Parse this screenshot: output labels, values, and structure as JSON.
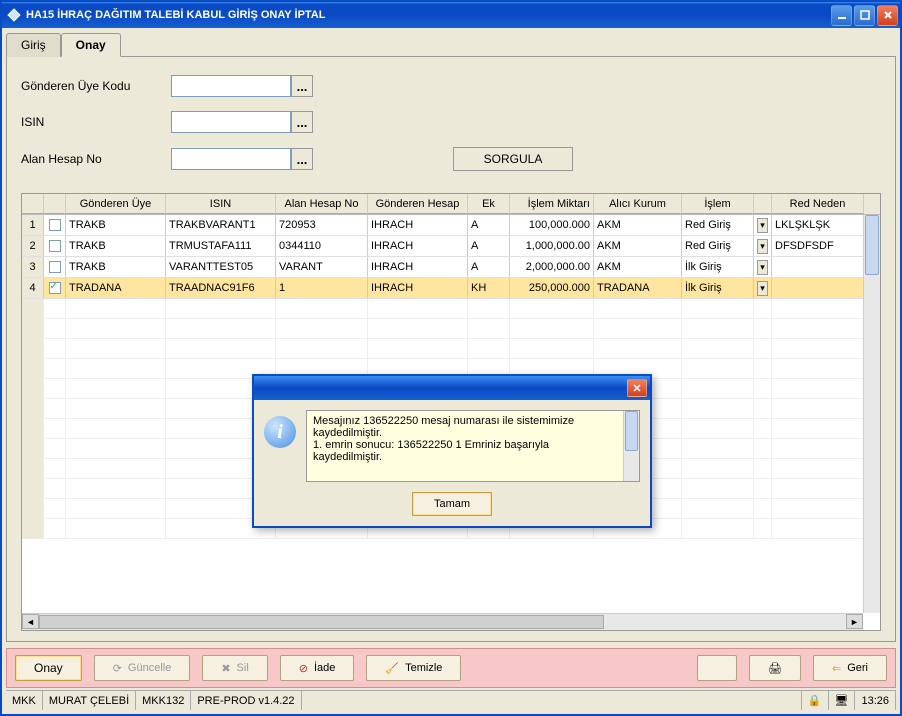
{
  "window": {
    "title": "HA15 İHRAÇ DAĞITIM TALEBİ KABUL GİRİŞ ONAY İPTAL"
  },
  "tabs": {
    "giris": "Giriş",
    "onay": "Onay"
  },
  "form": {
    "gonderen_uye_label": "Gönderen Üye Kodu",
    "isin_label": "ISIN",
    "alan_hesap_label": "Alan Hesap No",
    "gonderen_uye_value": "",
    "isin_value": "",
    "alan_hesap_value": "",
    "sorgula_label": "SORGULA"
  },
  "grid": {
    "headers": {
      "gonderen_uye": "Gönderen Üye",
      "isin": "ISIN",
      "alan_hesap": "Alan Hesap No",
      "gonderen_hesap": "Gönderen Hesap",
      "ek": "Ek",
      "islem_miktari": "İşlem Miktarı",
      "alici_kurum": "Alıcı Kurum",
      "islem": "İşlem",
      "red_neden": "Red Neden"
    },
    "rows": [
      {
        "idx": "1",
        "chk": false,
        "uye": "TRAKB",
        "isin": "TRAKBVARANT1",
        "alan": "720953",
        "gh": "IHRACH",
        "ek": "A",
        "miktar": "100,000.000",
        "kurum": "AKM",
        "islem": "Red Giriş",
        "red": "LKLŞKLŞK"
      },
      {
        "idx": "2",
        "chk": false,
        "uye": "TRAKB",
        "isin": "TRMUSTAFA111",
        "alan": "0344110",
        "gh": "IHRACH",
        "ek": "A",
        "miktar": "1,000,000.00",
        "kurum": "AKM",
        "islem": "Red Giriş",
        "red": "DFSDFSDF"
      },
      {
        "idx": "3",
        "chk": false,
        "uye": "TRAKB",
        "isin": "VARANTTEST05",
        "alan": "VARANT",
        "gh": "IHRACH",
        "ek": "A",
        "miktar": "2,000,000.00",
        "kurum": "AKM",
        "islem": "İlk Giriş",
        "red": ""
      },
      {
        "idx": "4",
        "chk": true,
        "uye": "TRADANA",
        "isin": "TRAADNAC91F6",
        "alan": "1",
        "gh": "IHRACH",
        "ek": "KH",
        "miktar": "250,000.000",
        "kurum": "TRADANA",
        "islem": "İlk Giriş",
        "red": ""
      }
    ]
  },
  "toolbar": {
    "onay": "Onay",
    "guncelle": "Güncelle",
    "sil": "Sil",
    "iade": "İade",
    "temizle": "Temizle",
    "geri": "Geri"
  },
  "statusbar": {
    "c1": "MKK",
    "c2": "MURAT ÇELEBİ",
    "c3": "MKK132",
    "c4": "PRE-PROD v1.4.22",
    "time": "13:26"
  },
  "modal": {
    "line1": "Mesajınız 136522250 mesaj numarası ile sistemimize kaydedilmiştir.",
    "line2": "1. emrin sonucu:  136522250   1   Emriniz başarıyla kaydedilmiştir.",
    "ok": "Tamam"
  },
  "icons": {
    "ellipsis": "..."
  }
}
